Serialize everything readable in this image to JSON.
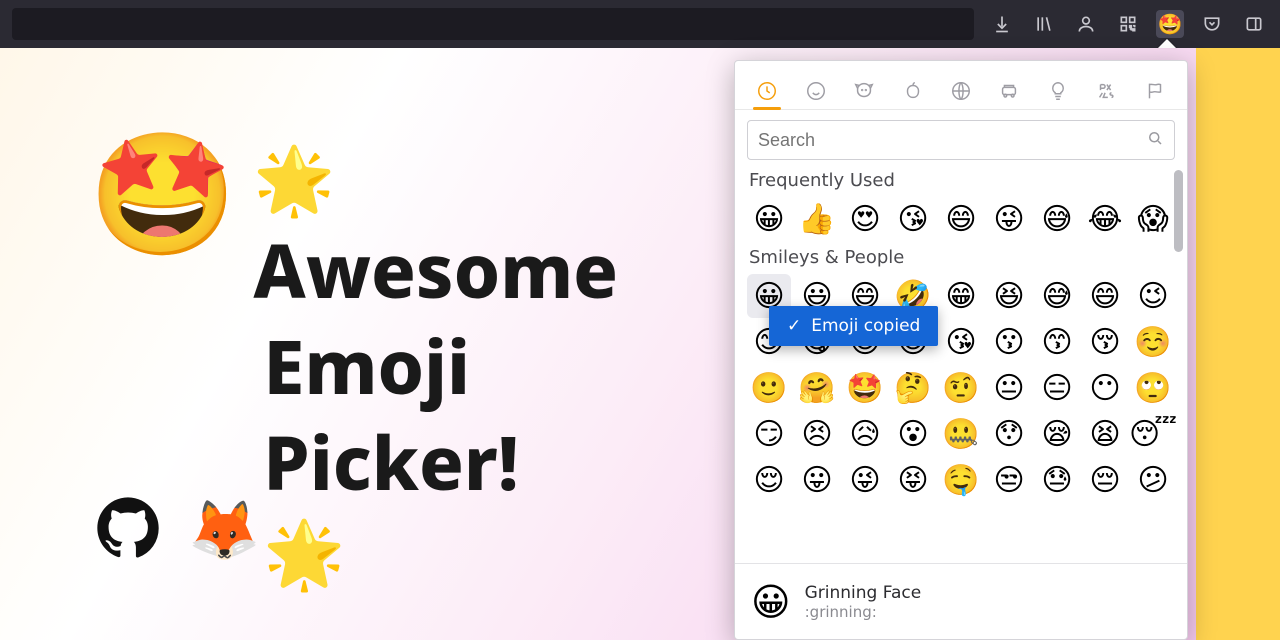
{
  "toolbar": {
    "icons": [
      "download",
      "library",
      "account",
      "qr",
      "extension-emoji",
      "pocket",
      "sidebar"
    ]
  },
  "headline": {
    "emoji": "🤩",
    "sparkle": "🌟",
    "line1": "Awesome",
    "line2": "Emoji",
    "line3": "Picker!"
  },
  "brands": {
    "github": "github-icon",
    "firefox": "🦊"
  },
  "picker": {
    "tabs": [
      "recent",
      "smileys",
      "animals",
      "food",
      "activity",
      "travel",
      "objects",
      "symbols",
      "flags"
    ],
    "active_tab": 0,
    "search_placeholder": "Search",
    "sections": {
      "frequent": {
        "title": "Frequently Used",
        "emojis": [
          "😀",
          "👍",
          "😍",
          "😘",
          "😄",
          "😜",
          "😅",
          "😂",
          "😱"
        ]
      },
      "smileys": {
        "title": "Smileys & People",
        "rows": [
          [
            "😀",
            "😃",
            "😄",
            "🤣",
            "😁",
            "😆",
            "😅",
            "😄",
            "😉"
          ],
          [
            "😊",
            "😋",
            "😎",
            "😍",
            "😘",
            "😗",
            "😙",
            "😚",
            "☺️"
          ],
          [
            "🙂",
            "🤗",
            "🤩",
            "🤔",
            "🤨",
            "😐",
            "😑",
            "😶",
            "🙄"
          ],
          [
            "😏",
            "😣",
            "😥",
            "😮",
            "🤐",
            "😯",
            "😪",
            "😫",
            "😴"
          ],
          [
            "😌",
            "😛",
            "😜",
            "😝",
            "🤤",
            "😒",
            "😓",
            "😔",
            "😕"
          ]
        ]
      }
    },
    "toast": "Emoji copied",
    "footer": {
      "preview": "😀",
      "name": "Grinning Face",
      "code": ":grinning:"
    }
  }
}
